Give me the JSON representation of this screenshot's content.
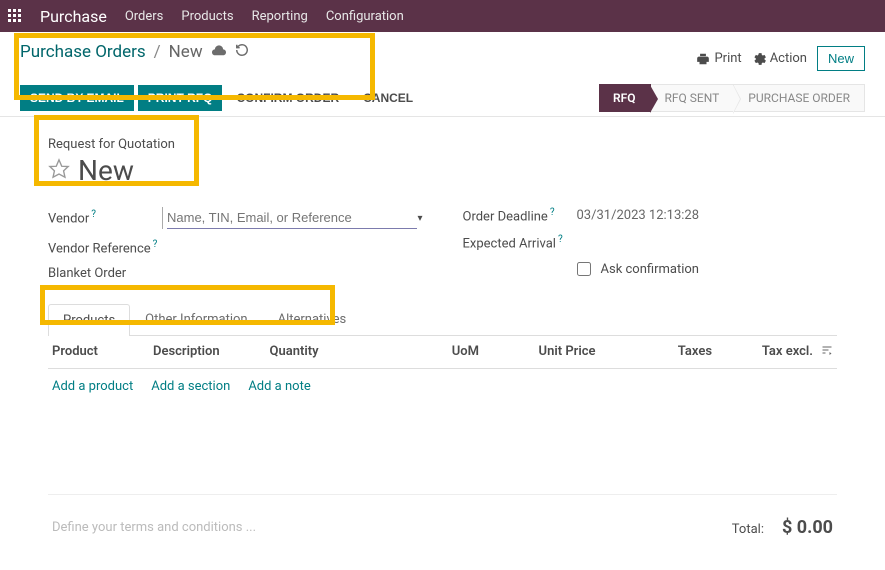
{
  "topbar": {
    "brand": "Purchase",
    "nav": [
      "Orders",
      "Products",
      "Reporting",
      "Configuration"
    ]
  },
  "breadcrumb": {
    "parent": "Purchase Orders",
    "current": "New"
  },
  "header_actions": {
    "print": "Print",
    "action": "Action",
    "new": "New"
  },
  "buttons": {
    "send_email": "SEND BY EMAIL",
    "print_rfq": "PRINT RFQ",
    "confirm": "CONFIRM ORDER",
    "cancel": "CANCEL"
  },
  "status": {
    "rfq": "RFQ",
    "rfq_sent": "RFQ SENT",
    "po": "PURCHASE ORDER"
  },
  "form": {
    "title": "Request for Quotation",
    "name": "New",
    "vendor_label": "Vendor",
    "vendor_placeholder": "Name, TIN, Email, or Reference",
    "vendor_ref_label": "Vendor Reference",
    "blanket_label": "Blanket Order",
    "deadline_label": "Order Deadline",
    "deadline_value": "03/31/2023 12:13:28",
    "expected_label": "Expected Arrival",
    "ask_conf_label": "Ask confirmation"
  },
  "tabs": [
    "Products",
    "Other Information",
    "Alternatives"
  ],
  "table": {
    "headers": {
      "product": "Product",
      "description": "Description",
      "quantity": "Quantity",
      "uom": "UoM",
      "unit_price": "Unit Price",
      "taxes": "Taxes",
      "tax_excl": "Tax excl."
    },
    "add_product": "Add a product",
    "add_section": "Add a section",
    "add_note": "Add a note"
  },
  "footer": {
    "terms_placeholder": "Define your terms and conditions ...",
    "total_label": "Total:",
    "total_value": "$ 0.00"
  }
}
